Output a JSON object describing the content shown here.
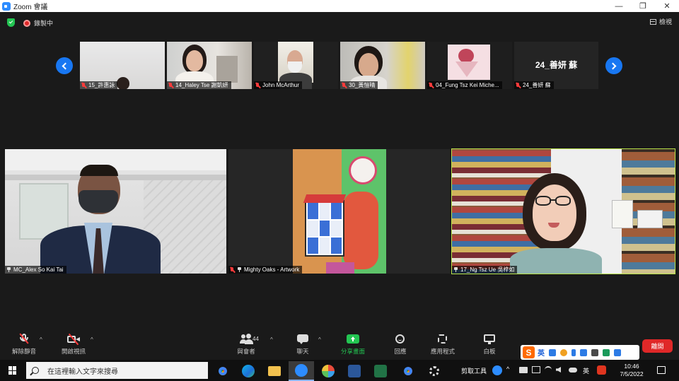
{
  "window": {
    "title": "Zoom 會議",
    "controls": [
      "—",
      "❐",
      "✕"
    ]
  },
  "status": {
    "recording_label": "錄製中",
    "view_label": "檢視"
  },
  "gallery_strip": [
    {
      "name": "15_許惠詠"
    },
    {
      "name": "14_Haley Tse 謝凱妍"
    },
    {
      "name": "John McArthur"
    },
    {
      "name": "30_黃愷晴"
    },
    {
      "name": "04_Fung Tsz Kei Miche..."
    },
    {
      "name": "24_善妍 蘇",
      "display_name": "24_善妍 蘇"
    }
  ],
  "main_tiles": [
    {
      "name": "MC_Alex So Kai Tai"
    },
    {
      "name": "Mighty Oaks - Artwork"
    },
    {
      "name": "17_Ng Tsz Ue 吳梓如"
    }
  ],
  "toolbar": {
    "unmute": "解除靜音",
    "start_video": "開啟視訊",
    "participants": "與會者",
    "participants_count": "44",
    "chat": "聊天",
    "share_screen": "分享畫面",
    "reactions": "回應",
    "apps": "應用程式",
    "whiteboard": "白板",
    "end": "離開"
  },
  "ime": {
    "logo": "S",
    "lang": "英"
  },
  "taskbar": {
    "search_placeholder": "在這裡輸入文字來搜尋",
    "tray_label": "剪取工具",
    "tray_lang": "英",
    "time": "10:46",
    "date": "7/5/2022"
  },
  "colors": {
    "zoom_blue": "#1877f2",
    "active_speaker": "#b9e34a",
    "end_red": "#e02828",
    "share_green": "#23c552"
  }
}
